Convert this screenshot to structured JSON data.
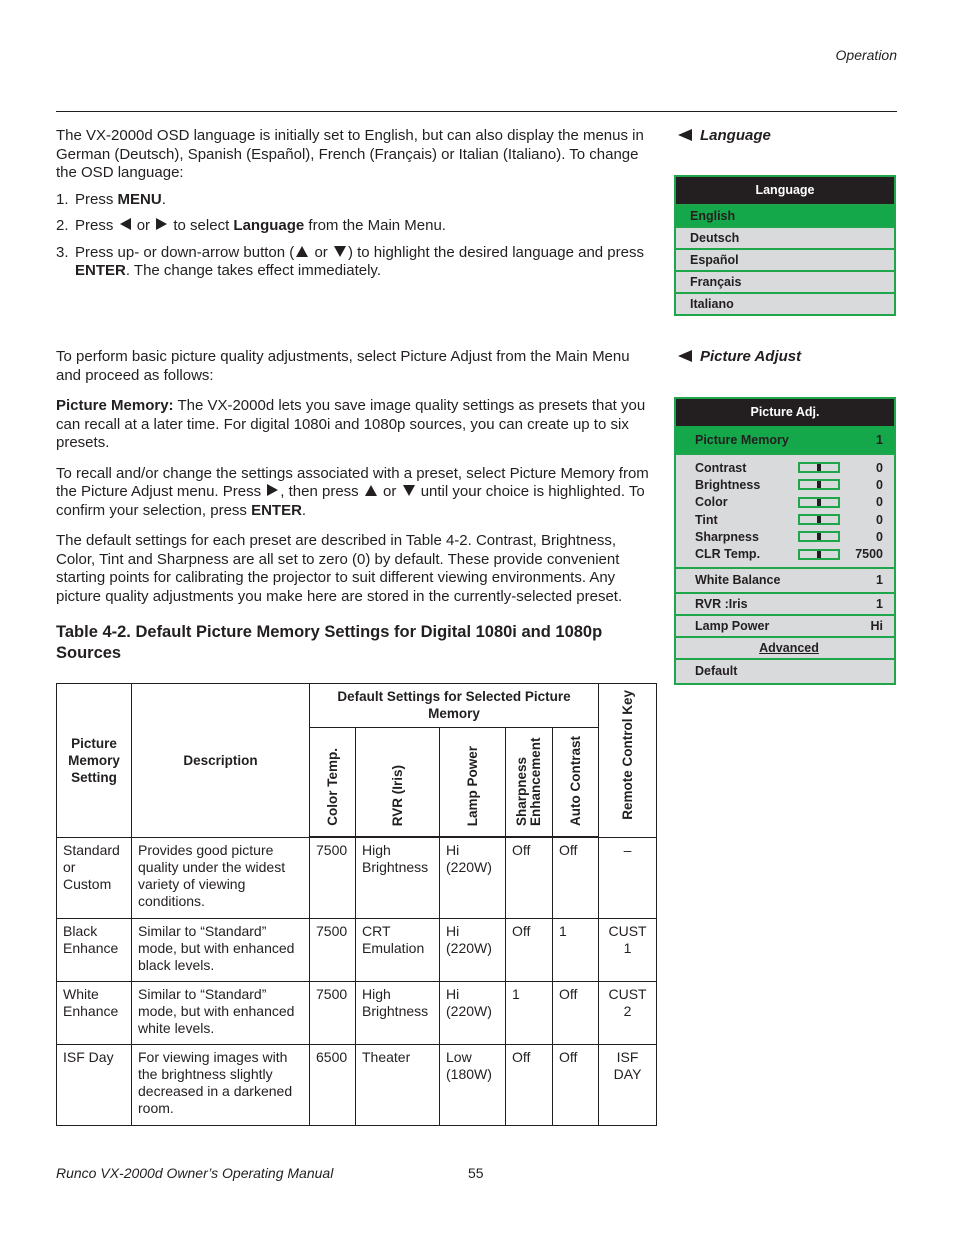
{
  "header": {
    "section": "Operation"
  },
  "language_section": {
    "heading": "Language",
    "intro": "The VX-2000d OSD language is initially set to English, but can also display the menus in German (Deutsch), Spanish (Español), French (Français) or Italian (Italiano). To change the OSD language:",
    "steps": [
      {
        "num": "1.",
        "pre": "Press ",
        "bold": "MENU",
        "post": "."
      },
      {
        "num": "2.",
        "pre": "Press",
        "mid1": "or",
        "mid2": "to select ",
        "bold": "Language",
        "post": " from the Main Menu."
      },
      {
        "num": "3.",
        "pre": "Press up- or down-arrow button (",
        "mid": "or",
        "post1": ") to highlight the desired language and press ",
        "bold": "ENTER",
        "post2": ". The change takes effect immediately."
      }
    ],
    "menu": {
      "title": "Language",
      "items": [
        "English",
        "Deutsch",
        "Español",
        "Français",
        "Italiano"
      ],
      "selected_index": 0
    }
  },
  "picture_adjust_section": {
    "heading": "Picture Adjust",
    "intro": "To perform basic picture quality adjustments, select Picture Adjust from the Main Menu and proceed as follows:",
    "memory_label": "Picture Memory:",
    "memory_text": " The VX-2000d lets you save image quality settings as presets that you can recall at a later time. For digital 1080i and 1080p sources, you can create up to six presets.",
    "recall_pre": "To recall and/or change the settings associated with a preset, select Picture Memory from the Picture Adjust menu. Press",
    "recall_mid1": ", then press",
    "recall_mid2": "or",
    "recall_mid3": "until your choice is highlighted. To confirm your selection, press ",
    "recall_bold": "ENTER",
    "recall_end": ".",
    "defaults_text": "The default settings for each preset are described in Table 4-2. Contrast, Brightness, Color, Tint and Sharpness are all set to zero (0) by default. These provide convenient starting points for calibrating the projector to suit different viewing environments. Any picture quality adjustments you make here are stored in the currently-selected preset.",
    "menu": {
      "title": "Picture Adj.",
      "picture_memory": {
        "label": "Picture Memory",
        "value": "1"
      },
      "sliders": [
        {
          "label": "Contrast",
          "value": "0",
          "level": 0.5
        },
        {
          "label": "Brightness",
          "value": "0",
          "level": 0.5
        },
        {
          "label": "Color",
          "value": "0",
          "level": 0.5
        },
        {
          "label": "Tint",
          "value": "0",
          "level": 0.5
        },
        {
          "label": "Sharpness",
          "value": "0",
          "level": 0.5
        },
        {
          "label": "CLR Temp.",
          "value": "7500",
          "level": 0.5
        }
      ],
      "white_balance": {
        "label": "White Balance",
        "value": "1"
      },
      "rvr_iris": {
        "label": "RVR :Iris",
        "value": "1"
      },
      "lamp_power": {
        "label": "Lamp Power",
        "value": "Hi"
      },
      "advanced": "Advanced",
      "default": "Default"
    }
  },
  "table": {
    "caption": "Table 4-2. Default Picture Memory Settings for Digital 1080i and 1080p Sources",
    "headers": {
      "setting": "Picture Memory Setting",
      "description": "Description",
      "group": "Default Settings for Selected Picture Memory",
      "color_temp": "Color Temp.",
      "rvr": "RVR (Iris)",
      "lamp": "Lamp Power",
      "sharp": "Sharpness Enhancement",
      "auto": "Auto Contrast",
      "key": "Remote Control Key"
    },
    "rows": [
      {
        "setting": "Standard or Custom",
        "description": "Provides good picture quality under the widest variety of viewing conditions.",
        "color_temp": "7500",
        "rvr": "High Brightness",
        "lamp": "Hi (220W)",
        "sharp": "Off",
        "auto": "Off",
        "key": "–"
      },
      {
        "setting": "Black Enhance",
        "description": "Similar to “Standard” mode, but with enhanced black levels.",
        "color_temp": "7500",
        "rvr": "CRT Emulation",
        "lamp": "Hi (220W)",
        "sharp": "Off",
        "auto": "1",
        "key": "CUST 1"
      },
      {
        "setting": "White Enhance",
        "description": "Similar to “Standard” mode, but with enhanced white levels.",
        "color_temp": "7500",
        "rvr": "High Brightness",
        "lamp": "Hi (220W)",
        "sharp": "1",
        "auto": "Off",
        "key": "CUST 2"
      },
      {
        "setting": "ISF Day",
        "description": "For viewing images with the brightness slightly decreased in a darkened room.",
        "color_temp": "6500",
        "rvr": "Theater",
        "lamp": "Low (180W)",
        "sharp": "Off",
        "auto": "Off",
        "key": "ISF DAY"
      }
    ]
  },
  "footer": {
    "manual_title": "Runco VX-2000d Owner’s Operating Manual",
    "page_number": "55"
  },
  "colors": {
    "osd_green": "#14a84a",
    "osd_border": "#1fa64b",
    "osd_bg": "#d9dadc",
    "osd_title_bg": "#231f20"
  }
}
